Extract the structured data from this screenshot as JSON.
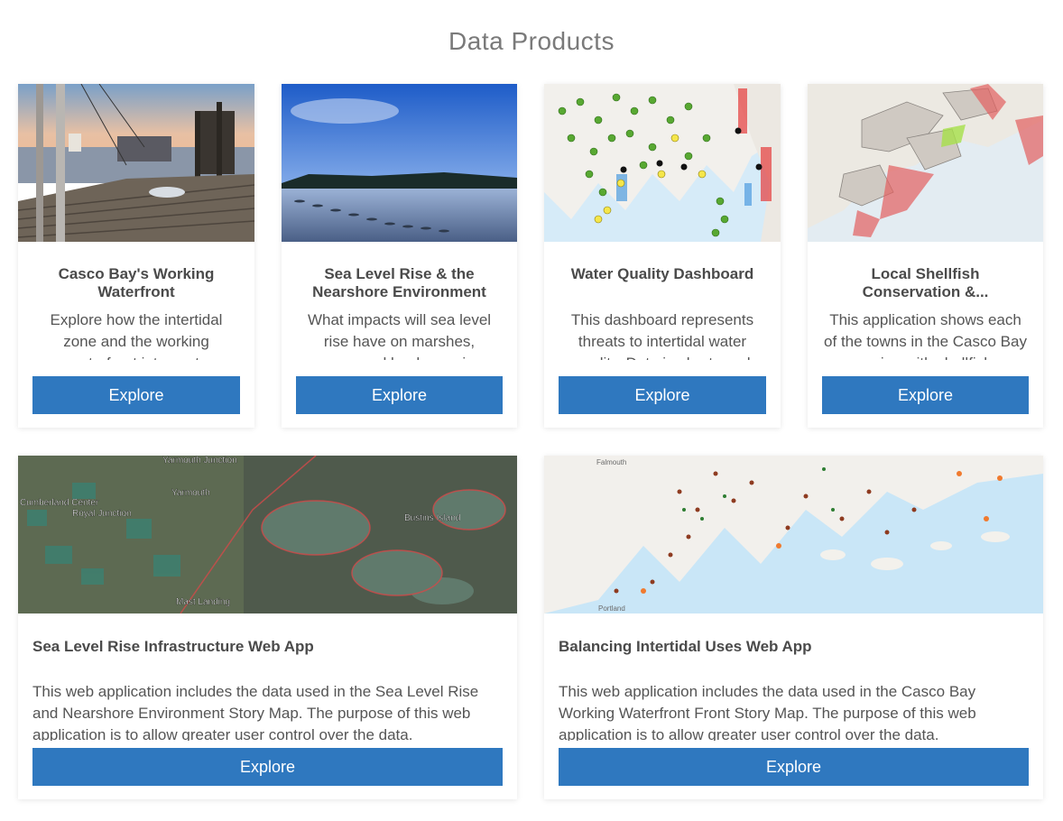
{
  "page": {
    "title": "Data Products"
  },
  "cards": [
    {
      "title": "Casco Bay's Working Waterfront",
      "description": "Explore how the intertidal zone and the working waterfront intersect.",
      "button": "Explore",
      "thumbnail": "photo-dock-sunset"
    },
    {
      "title": "Sea Level Rise & the Nearshore Environment",
      "description": "What impacts will sea level rise have on marshes, conserved lands, marine habitats?",
      "button": "Explore",
      "thumbnail": "photo-tidal-flat"
    },
    {
      "title": "Water Quality Dashboard",
      "description": "This dashboard represents threats to intertidal water quality. Data in charts and maps.",
      "button": "Explore",
      "thumbnail": "map-water-quality"
    },
    {
      "title": "Local Shellfish Conservation & Management",
      "title_display": "Local Shellfish Conservation &...",
      "description": "This application shows each of the towns in the Casco Bay region with shellfish ordinances.",
      "button": "Explore",
      "thumbnail": "map-shellfish"
    },
    {
      "title": "Sea Level Rise Infrastructure Web App",
      "description": "This web application includes the data used in the Sea Level Rise and Nearshore Environment Story Map. The purpose of this web application is to allow greater user control over the data.",
      "button": "Explore",
      "thumbnail": "satellite-map",
      "map_labels": [
        "Yarmouth Junction",
        "Yarmouth",
        "Cumberland Center",
        "Royal Junction",
        "Bustins Island",
        "Mast Landing"
      ]
    },
    {
      "title": "Balancing Intertidal Uses Web App",
      "description": "This web application includes the data used in the Casco Bay Working Waterfront Front Story Map. The purpose of this web application is to allow greater user control over the data.",
      "button": "Explore",
      "thumbnail": "map-intertidal-uses",
      "map_labels": [
        "Falmouth",
        "Portland"
      ]
    }
  ],
  "colors": {
    "button": "#2f78bf",
    "title": "#7a7a7a"
  }
}
